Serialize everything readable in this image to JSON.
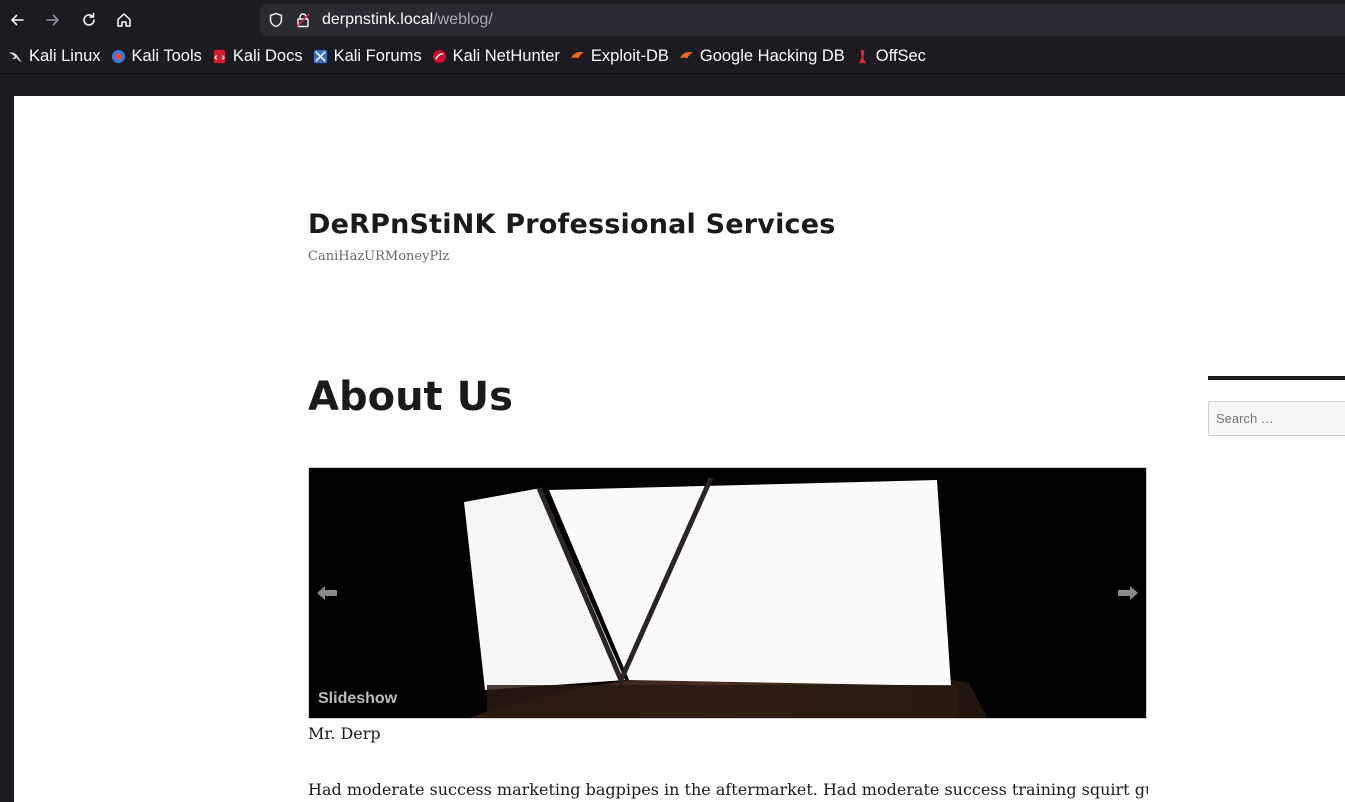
{
  "browser": {
    "url_host": "derpnstink.local",
    "url_path": "/weblog/",
    "bookmarks": [
      {
        "label": "Kali Linux",
        "icon": "kali-dragon-icon"
      },
      {
        "label": "Kali Tools",
        "icon": "kali-tools-icon"
      },
      {
        "label": "Kali Docs",
        "icon": "kali-docs-icon"
      },
      {
        "label": "Kali Forums",
        "icon": "kali-forums-icon"
      },
      {
        "label": "Kali NetHunter",
        "icon": "kali-nethunter-icon"
      },
      {
        "label": "Exploit-DB",
        "icon": "exploit-db-icon"
      },
      {
        "label": "Google Hacking DB",
        "icon": "ghdb-icon"
      },
      {
        "label": "OffSec",
        "icon": "offsec-icon"
      }
    ]
  },
  "site": {
    "title": "DeRPnStiNK Professional Services",
    "description": "CaniHazURMoneyPlz"
  },
  "page": {
    "title": "About Us",
    "slideshow_label": "Slideshow",
    "image_caption": "Mr. Derp",
    "body": "Had moderate success marketing bagpipes in the aftermarket. Had moderate success training squirt guns"
  },
  "sidebar": {
    "search_placeholder": "Search …"
  },
  "colors": {
    "chrome_bg": "#1c1b22",
    "urlbar_bg": "#2b2a33",
    "page_bg": "#ffffff",
    "text": "#1a1a1a"
  }
}
